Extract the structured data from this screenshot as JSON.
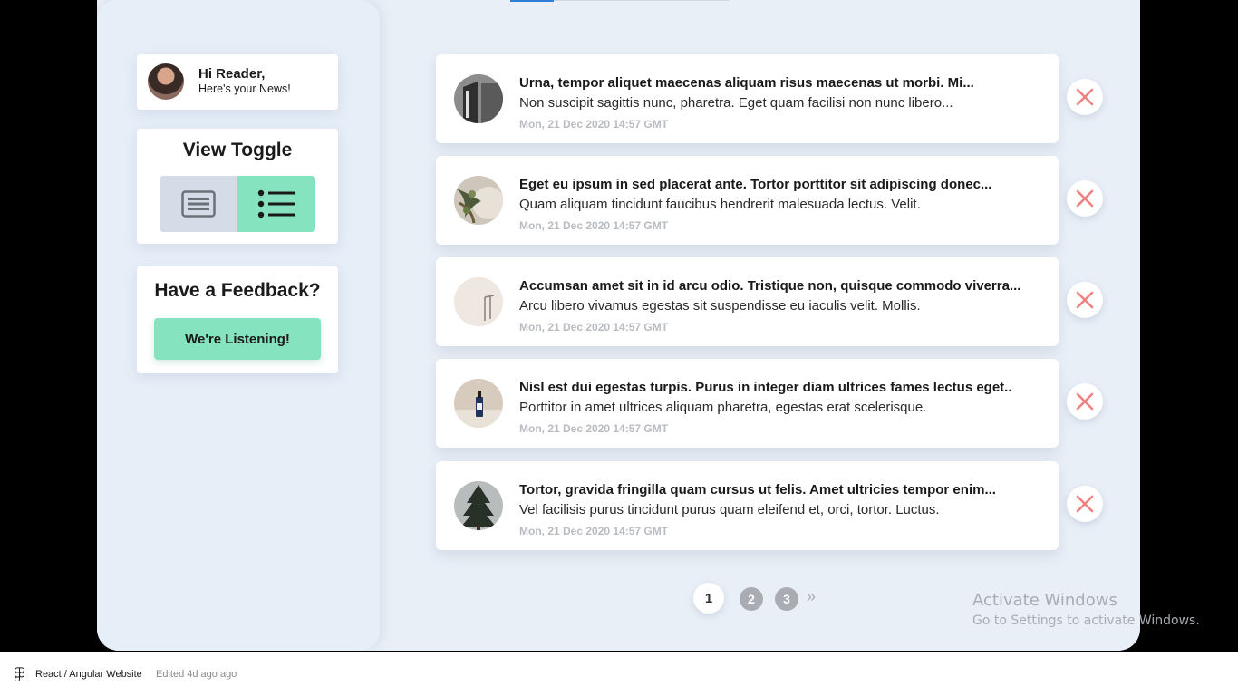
{
  "greeting": {
    "title": "Hi Reader,",
    "subtitle": "Here's your News!"
  },
  "view_toggle": {
    "title": "View Toggle",
    "active": "list"
  },
  "feedback": {
    "title": "Have a Feedback?",
    "button_label": "We're Listening!"
  },
  "news": [
    {
      "title": "Urna, tempor aliquet maecenas aliquam risus maecenas ut morbi. Mi...",
      "body": "Non suscipit sagittis nunc, pharetra. Eget quam facilisi non nunc libero...",
      "date": "Mon, 21 Dec 2020 14:57 GMT",
      "thumb_icon": "building-photo"
    },
    {
      "title": "Eget eu ipsum in sed placerat ante. Tortor porttitor sit adipiscing donec...",
      "body": "Quam aliquam tincidunt faucibus hendrerit malesuada lectus. Velit.",
      "date": "Mon, 21 Dec 2020 14:57 GMT",
      "thumb_icon": "plant-photo"
    },
    {
      "title": "Accumsan amet sit in id arcu odio. Tristique non, quisque commodo viverra...",
      "body": "Arcu libero vivamus egestas sit suspendisse eu iaculis velit. Mollis.",
      "date": "Mon, 21 Dec 2020 14:57 GMT",
      "thumb_icon": "wall-photo"
    },
    {
      "title": "Nisl est dui egestas turpis. Purus in integer diam ultrices fames lectus eget..",
      "body": "Porttitor in amet ultrices aliquam pharetra, egestas erat scelerisque.",
      "date": "Mon, 21 Dec 2020 14:57 GMT",
      "thumb_icon": "bottle-photo"
    },
    {
      "title": "Tortor, gravida fringilla quam cursus ut felis. Amet ultricies tempor enim...",
      "body": "Vel facilisis purus tincidunt purus quam eleifend et, orci, tortor. Luctus.",
      "date": "Mon, 21 Dec 2020 14:57 GMT",
      "thumb_icon": "tree-photo"
    }
  ],
  "pagination": {
    "current": "1",
    "pages": [
      "2",
      "3"
    ],
    "next": "»"
  },
  "watermark": {
    "title": "Activate Windows",
    "subtitle": "Go to Settings to activate Windows."
  },
  "bottom_bar": {
    "title": "React / Angular Website",
    "edited": "Edited 4d ago ago"
  },
  "colors": {
    "accent": "#86e3c0",
    "close": "#f08080",
    "background": "#e9eff7",
    "tab_active": "#2d7fd6"
  }
}
